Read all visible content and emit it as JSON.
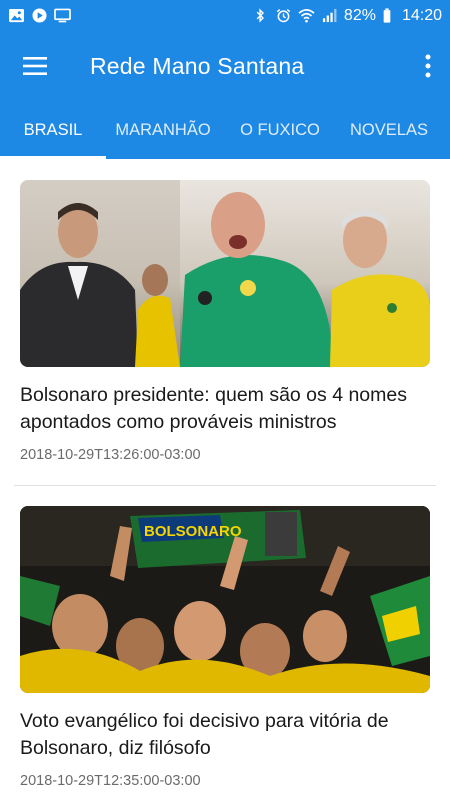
{
  "status_bar": {
    "battery": "82%",
    "time": "14:20",
    "left_icons": [
      "gallery-icon",
      "play-icon",
      "screen-icon"
    ],
    "right_icons": [
      "bluetooth-icon",
      "alarm-icon",
      "wifi-icon",
      "signal-icon",
      "battery-icon"
    ]
  },
  "app_bar": {
    "title": "Rede Mano Santana",
    "menu_icon": "hamburger-menu-icon",
    "overflow_icon": "more-vert-icon"
  },
  "tabs": [
    {
      "label": "BRASIL",
      "selected": true
    },
    {
      "label": "MARANHÃO",
      "selected": false
    },
    {
      "label": "O FUXICO",
      "selected": false
    },
    {
      "label": "NOVELAS",
      "selected": false
    }
  ],
  "articles": [
    {
      "title": "Bolsonaro presidente: quem são os 4 nomes apontados como prováveis ministros",
      "date": "2018-10-29T13:26:00-03:00"
    },
    {
      "title": "Voto evangélico foi decisivo para vitória de Bolsonaro, diz filósofo",
      "date": "2018-10-29T12:35:00-03:00",
      "image_banner_text": "BOLSONARO"
    }
  ],
  "colors": {
    "primary": "#1e88e5",
    "text": "#1a1a1a",
    "date": "#6b6b6b"
  }
}
